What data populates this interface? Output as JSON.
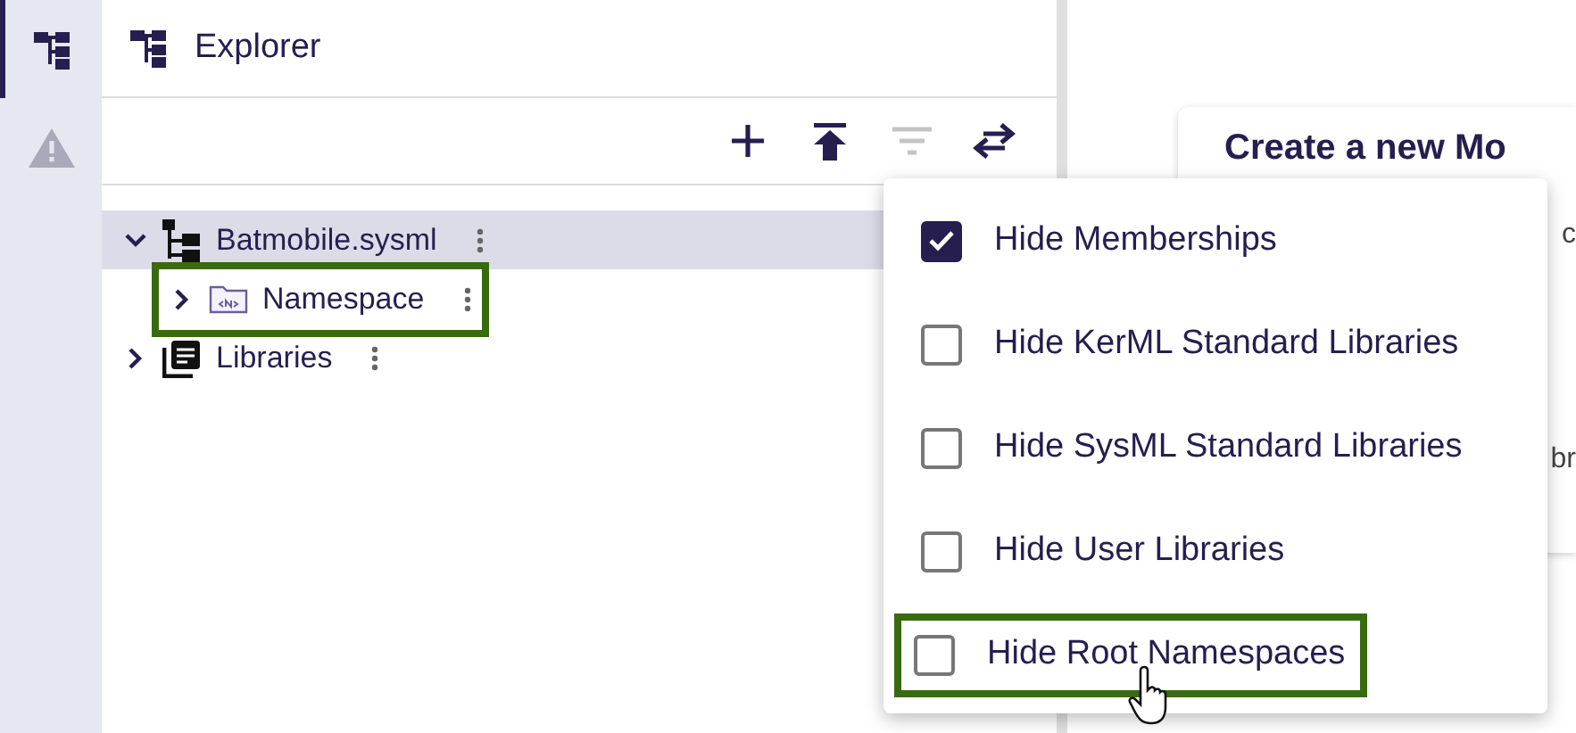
{
  "sidebar": {
    "items": [
      {
        "kind": "explorer",
        "selected": true
      },
      {
        "kind": "warning",
        "selected": false
      }
    ]
  },
  "explorer": {
    "title": "Explorer",
    "toolbar": [
      {
        "kind": "add",
        "disabled": false
      },
      {
        "kind": "upload",
        "disabled": false
      },
      {
        "kind": "filter",
        "disabled": true
      },
      {
        "kind": "swap",
        "disabled": false
      }
    ],
    "tree": [
      {
        "label": "Batmobile.sysml",
        "kind": "model",
        "expanded": true,
        "selected": true,
        "highlighted": false,
        "children": [
          {
            "label": "Namespace",
            "kind": "namespace",
            "expanded": false,
            "selected": false,
            "highlighted": true
          }
        ]
      },
      {
        "label": "Libraries",
        "kind": "library",
        "expanded": false,
        "selected": false,
        "highlighted": false
      }
    ]
  },
  "card": {
    "title": "Create a new Mo",
    "line_1": "c",
    "line_2": "br"
  },
  "filter_menu": {
    "items": [
      {
        "label": "Hide Memberships",
        "checked": true,
        "highlighted": false
      },
      {
        "label": "Hide KerML Standard Libraries",
        "checked": false,
        "highlighted": false
      },
      {
        "label": "Hide SysML Standard Libraries",
        "checked": false,
        "highlighted": false
      },
      {
        "label": "Hide User Libraries",
        "checked": false,
        "highlighted": false
      },
      {
        "label": "Hide Root Namespaces",
        "checked": false,
        "highlighted": true
      }
    ]
  }
}
